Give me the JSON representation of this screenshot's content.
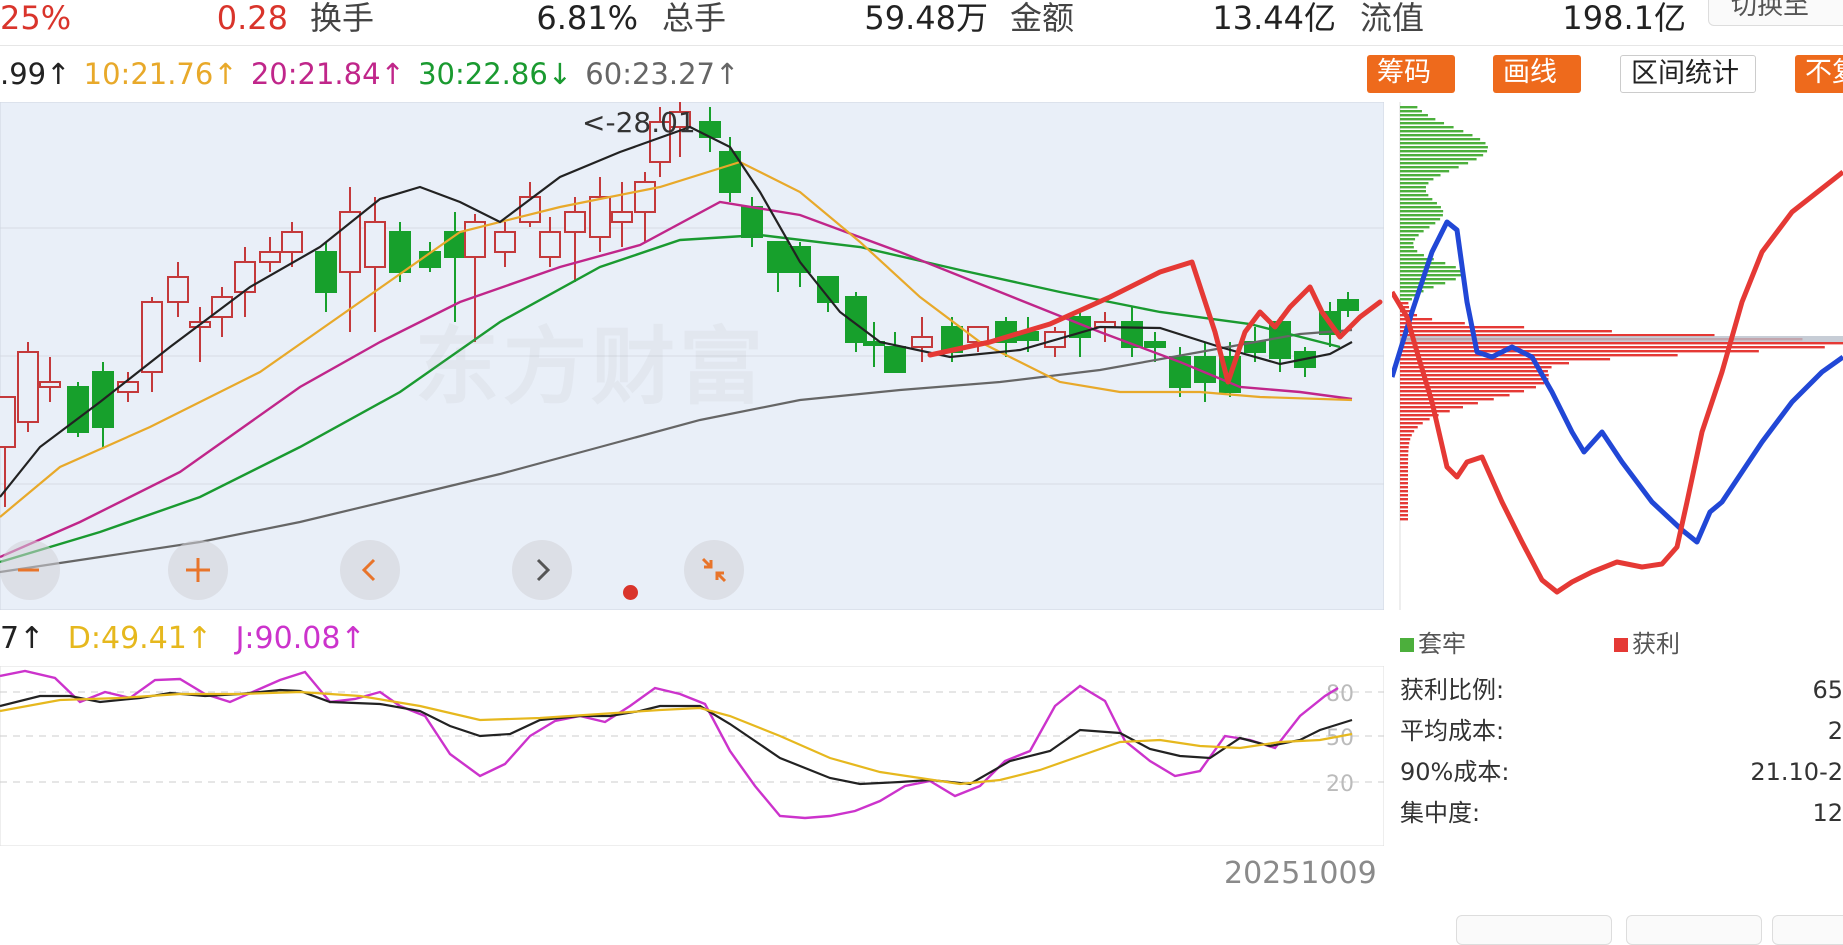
{
  "stats": {
    "change_pct": "25%",
    "change_amt": "0.28",
    "turnover_label": "换手",
    "turnover_value": "6.81%",
    "volume_label": "总手",
    "volume_value": "59.48万",
    "amount_label": "金额",
    "amount_value": "13.44亿",
    "float_cap_label": "流值",
    "float_cap_value": "198.1亿",
    "top_button_label": "切换至"
  },
  "ma_row": {
    "ma5": ".99↑",
    "ma10": "10:21.76↑",
    "ma20": "20:21.84↑",
    "ma30": "30:22.86↓",
    "ma60": "60:23.27↑",
    "colors": {
      "ma5": "#222222",
      "ma10": "#e8a92a",
      "ma20": "#c0268a",
      "ma30": "#1a9a30",
      "ma60": "#666666"
    }
  },
  "toolbar": {
    "chips_label": "筹码",
    "draw_label": "画线",
    "range_stats_label": "区间统计",
    "more_label": "不复"
  },
  "main_chart": {
    "high_annotation": "<-28.01",
    "watermark": "东方财富",
    "nav_icons": [
      "minus-icon",
      "plus-icon",
      "chevron-left-icon",
      "chevron-right-icon",
      "collapse-icon"
    ],
    "colors": {
      "up": "#c4393b",
      "down": "#17a02c",
      "bg": "#e9eff8"
    }
  },
  "kdj": {
    "k_label": "7↑",
    "d_label": "D:49.41↑",
    "j_label": "J:90.08↑",
    "levels": [
      "80",
      "50",
      "20"
    ],
    "colors": {
      "k": "#222222",
      "d": "#e6b81e",
      "j": "#cc33cc"
    }
  },
  "date_label": "20251009",
  "chip_panel": {
    "legend_trapped": "套牢",
    "legend_profit": "获利",
    "colors": {
      "trapped": "#4caf3c",
      "profit": "#e53935"
    },
    "rows": [
      {
        "key": "获利比例:",
        "value": "65"
      },
      {
        "key": "平均成本:",
        "value": "2"
      },
      {
        "key": "90%成本:",
        "value": "21.10-2"
      },
      {
        "key": "集中度:",
        "value": "12"
      }
    ]
  }
}
